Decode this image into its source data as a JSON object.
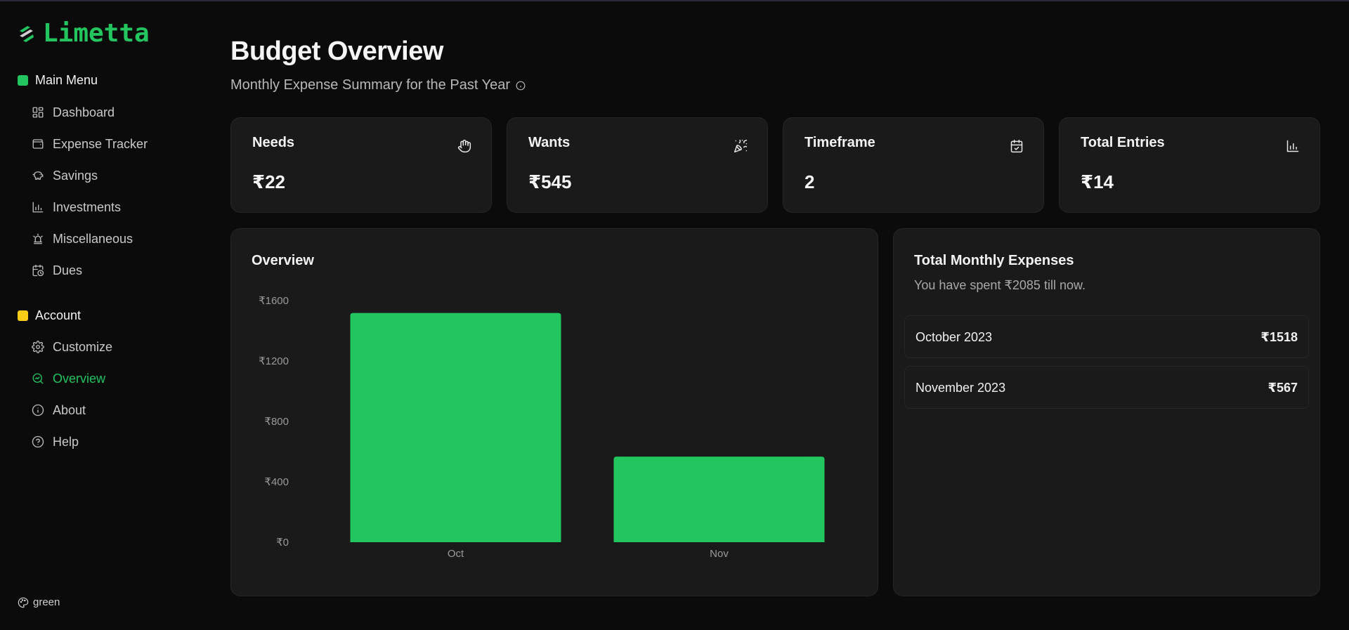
{
  "app": {
    "name": "Limetta",
    "accent": "#22c55e"
  },
  "sidebar": {
    "main_menu": {
      "label": "Main Menu",
      "color": "#22c55e",
      "items": [
        {
          "label": "Dashboard",
          "icon": "dashboard-icon"
        },
        {
          "label": "Expense Tracker",
          "icon": "wallet-icon"
        },
        {
          "label": "Savings",
          "icon": "piggy-bank-icon"
        },
        {
          "label": "Investments",
          "icon": "bar-chart-icon"
        },
        {
          "label": "Miscellaneous",
          "icon": "alarm-icon"
        },
        {
          "label": "Dues",
          "icon": "calendar-clock-icon"
        }
      ]
    },
    "account": {
      "label": "Account",
      "color": "#facc15",
      "items": [
        {
          "label": "Customize",
          "icon": "gear-icon"
        },
        {
          "label": "Overview",
          "icon": "search-chart-icon",
          "active": true
        },
        {
          "label": "About",
          "icon": "info-icon"
        },
        {
          "label": "Help",
          "icon": "help-icon"
        }
      ]
    },
    "theme_label": "green"
  },
  "page": {
    "title": "Budget Overview",
    "subtitle": "Monthly Expense Summary for the Past Year"
  },
  "stats": [
    {
      "label": "Needs",
      "value": "₹22",
      "icon": "hand-icon"
    },
    {
      "label": "Wants",
      "value": "₹545",
      "icon": "party-popper-icon"
    },
    {
      "label": "Timeframe",
      "value": "2",
      "icon": "calendar-check-icon"
    },
    {
      "label": "Total Entries",
      "value": "₹14",
      "icon": "bar-chart-icon"
    }
  ],
  "overview": {
    "title": "Overview"
  },
  "chart_data": {
    "type": "bar",
    "title": "Overview",
    "categories": [
      "Oct",
      "Nov"
    ],
    "values": [
      1518,
      567
    ],
    "yticks": [
      "₹0",
      "₹400",
      "₹800",
      "₹1200",
      "₹1600"
    ],
    "ylim": [
      0,
      1600
    ],
    "bar_color": "#22c55e",
    "grid": false
  },
  "monthly": {
    "title": "Total Monthly Expenses",
    "subtitle": "You have spent ₹2085 till now.",
    "rows": [
      {
        "month": "October 2023",
        "amount": "₹1518"
      },
      {
        "month": "November 2023",
        "amount": "₹567"
      }
    ]
  }
}
